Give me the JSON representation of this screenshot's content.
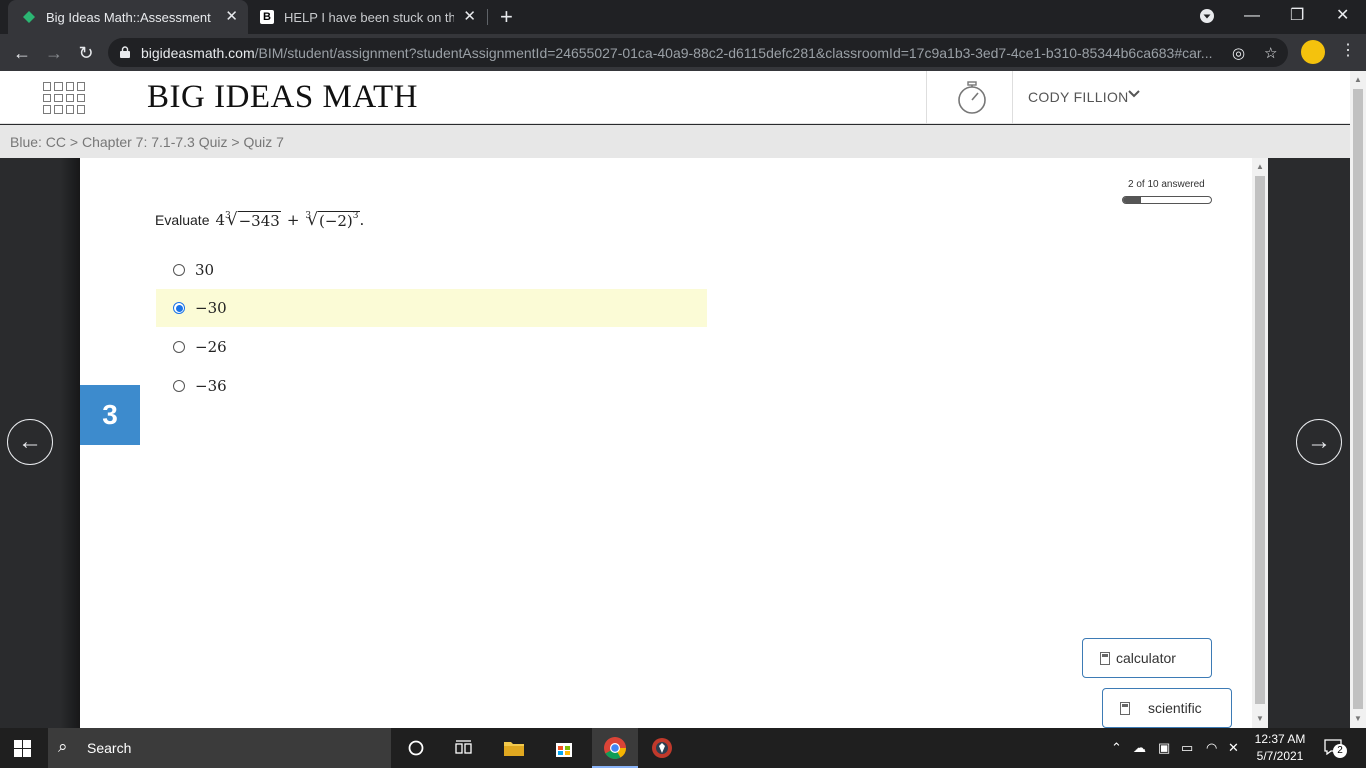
{
  "browser": {
    "tabs": [
      {
        "title": "Big Ideas Math::Assessment",
        "favicon": "big-ideas-favicon",
        "active": true
      },
      {
        "title": "HELP I have been stuck on this pr",
        "favicon": "brainly-favicon",
        "active": false
      }
    ],
    "url_host": "bigideasmath.com",
    "url_path": "/BIM/student/assignment?studentAssignmentId=24655027-01ca-40a9-88c2-d6115defc281&classroomId=17c9a1b3-3ed7-4ce1-b310-85344b6ca683#car..."
  },
  "header": {
    "logo": "BIG IDEAS MATH",
    "user": "CODY FILLION"
  },
  "breadcrumb": "Blue: CC > Chapter 7: 7.1-7.3 Quiz > Quiz 7",
  "progress": {
    "label": "2 of 10 answered",
    "answered": 2,
    "total": 10
  },
  "question": {
    "number": "3",
    "prompt": "Evaluate",
    "expr": {
      "coef": "4",
      "root1_index": "3",
      "root1_radicand": "−343",
      "plus": "+",
      "root2_index": "3",
      "root2_radicand": "(−2)",
      "root2_exp": "3",
      "end": "."
    },
    "options": [
      {
        "label": "30",
        "selected": false
      },
      {
        "label": "−30",
        "selected": true
      },
      {
        "label": "−26",
        "selected": false
      },
      {
        "label": "−36",
        "selected": false
      }
    ]
  },
  "tools": {
    "calculator": "calculator",
    "scientific": "scientific"
  },
  "taskbar": {
    "search": "Search",
    "time": "12:37 AM",
    "date": "5/7/2021",
    "notifications": "2"
  },
  "colors": {
    "accent": "#3d8bcd",
    "selected_row": "#fbfbd6",
    "radio_checked": "#1a73e8"
  }
}
